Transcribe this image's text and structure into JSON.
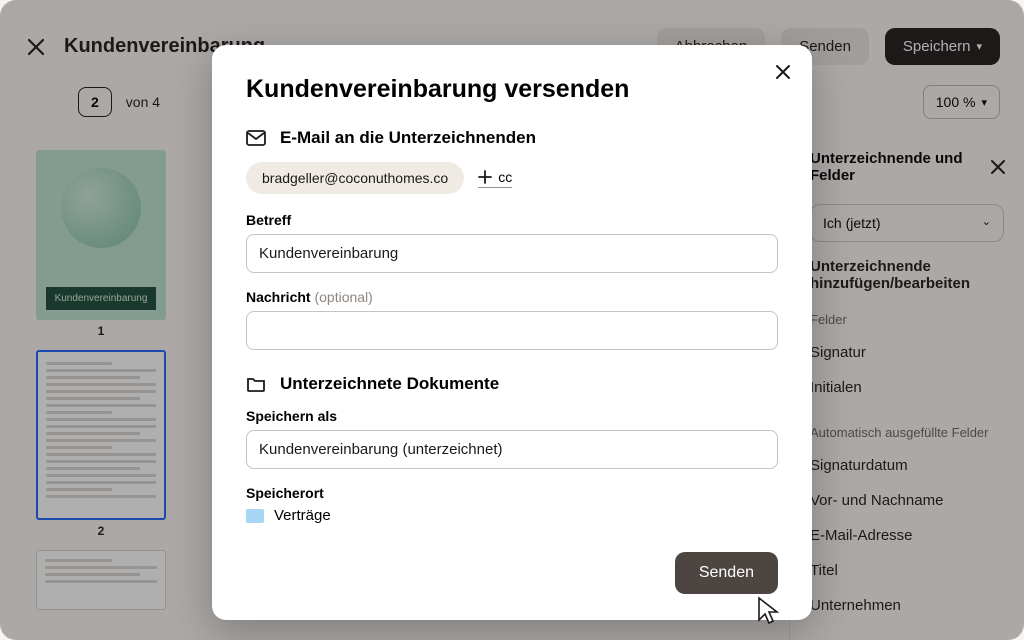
{
  "toolbar": {
    "doc_title": "Kundenvereinbarung",
    "cancel": "Abbrechen",
    "send": "Senden",
    "save": "Speichern"
  },
  "subbar": {
    "page_current": "2",
    "page_of": "von 4",
    "zoom": "100 %"
  },
  "thumbs": {
    "t1_label": "Kundenvereinbarung",
    "n1": "1",
    "n2": "2"
  },
  "rpanel": {
    "title": "Unterzeichnende und Felder",
    "who": "Ich (jetzt)",
    "edit_link_a": "Unterzeichnende",
    "edit_link_b": "hinzufügen/bearbeiten",
    "sect_fields": "Felder",
    "f1": "Signatur",
    "f2": "Initialen",
    "sect_auto": "Automatisch ausgefüllte Felder",
    "a1": "Signaturdatum",
    "a2": "Vor- und Nachname",
    "a3": "E-Mail-Adresse",
    "a4": "Titel",
    "a5": "Unternehmen"
  },
  "modal": {
    "title": "Kundenvereinbarung versenden",
    "sect_email": "E-Mail an die Unterzeichnenden",
    "email_chip": "bradgeller@coconuthomes.co",
    "cc": "cc",
    "subject_label": "Betreff",
    "subject_value": "Kundenvereinbarung",
    "message_label": "Nachricht",
    "message_opt": "(optional)",
    "sect_signed": "Unterzeichnete Dokumente",
    "saveas_label": "Speichern als",
    "saveas_value": "Kundenvereinbarung (unterzeichnet)",
    "location_label": "Speicherort",
    "location_value": "Verträge",
    "send": "Senden"
  }
}
